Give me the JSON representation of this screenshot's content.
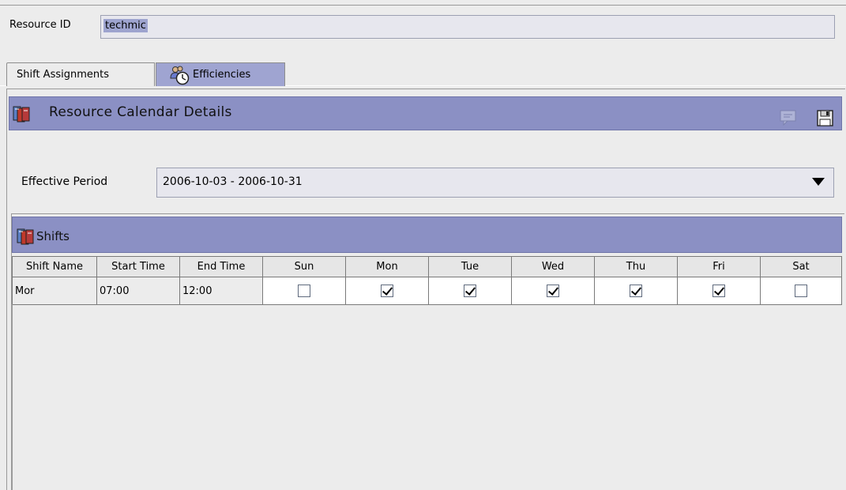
{
  "resource": {
    "label": "Resource ID",
    "value": "techmic"
  },
  "tabs": [
    {
      "label": "Shift Assignments",
      "active": true
    },
    {
      "label": "Efficiencies",
      "active": false
    }
  ],
  "panel": {
    "title": "Resource Calendar Details"
  },
  "effective_period": {
    "label": "Effective Period",
    "value": "2006-10-03 - 2006-10-31"
  },
  "shifts": {
    "title": "Shifts",
    "columns": [
      "Shift Name",
      "Start Time",
      "End Time",
      "Sun",
      "Mon",
      "Tue",
      "Wed",
      "Thu",
      "Fri",
      "Sat"
    ],
    "rows": [
      {
        "name": "Mor",
        "start": "07:00",
        "end": "12:00",
        "days": [
          false,
          true,
          true,
          true,
          true,
          true,
          false
        ]
      }
    ]
  },
  "colors": {
    "header_bar": "#8b90c4",
    "selection": "#9ea4cf",
    "tab_inactive": "#9fa4d1"
  },
  "icons": {
    "panel": "binder-icon",
    "tab": "clock-people-icon",
    "action": "comment-icon",
    "save": "floppy-disk-icon"
  }
}
